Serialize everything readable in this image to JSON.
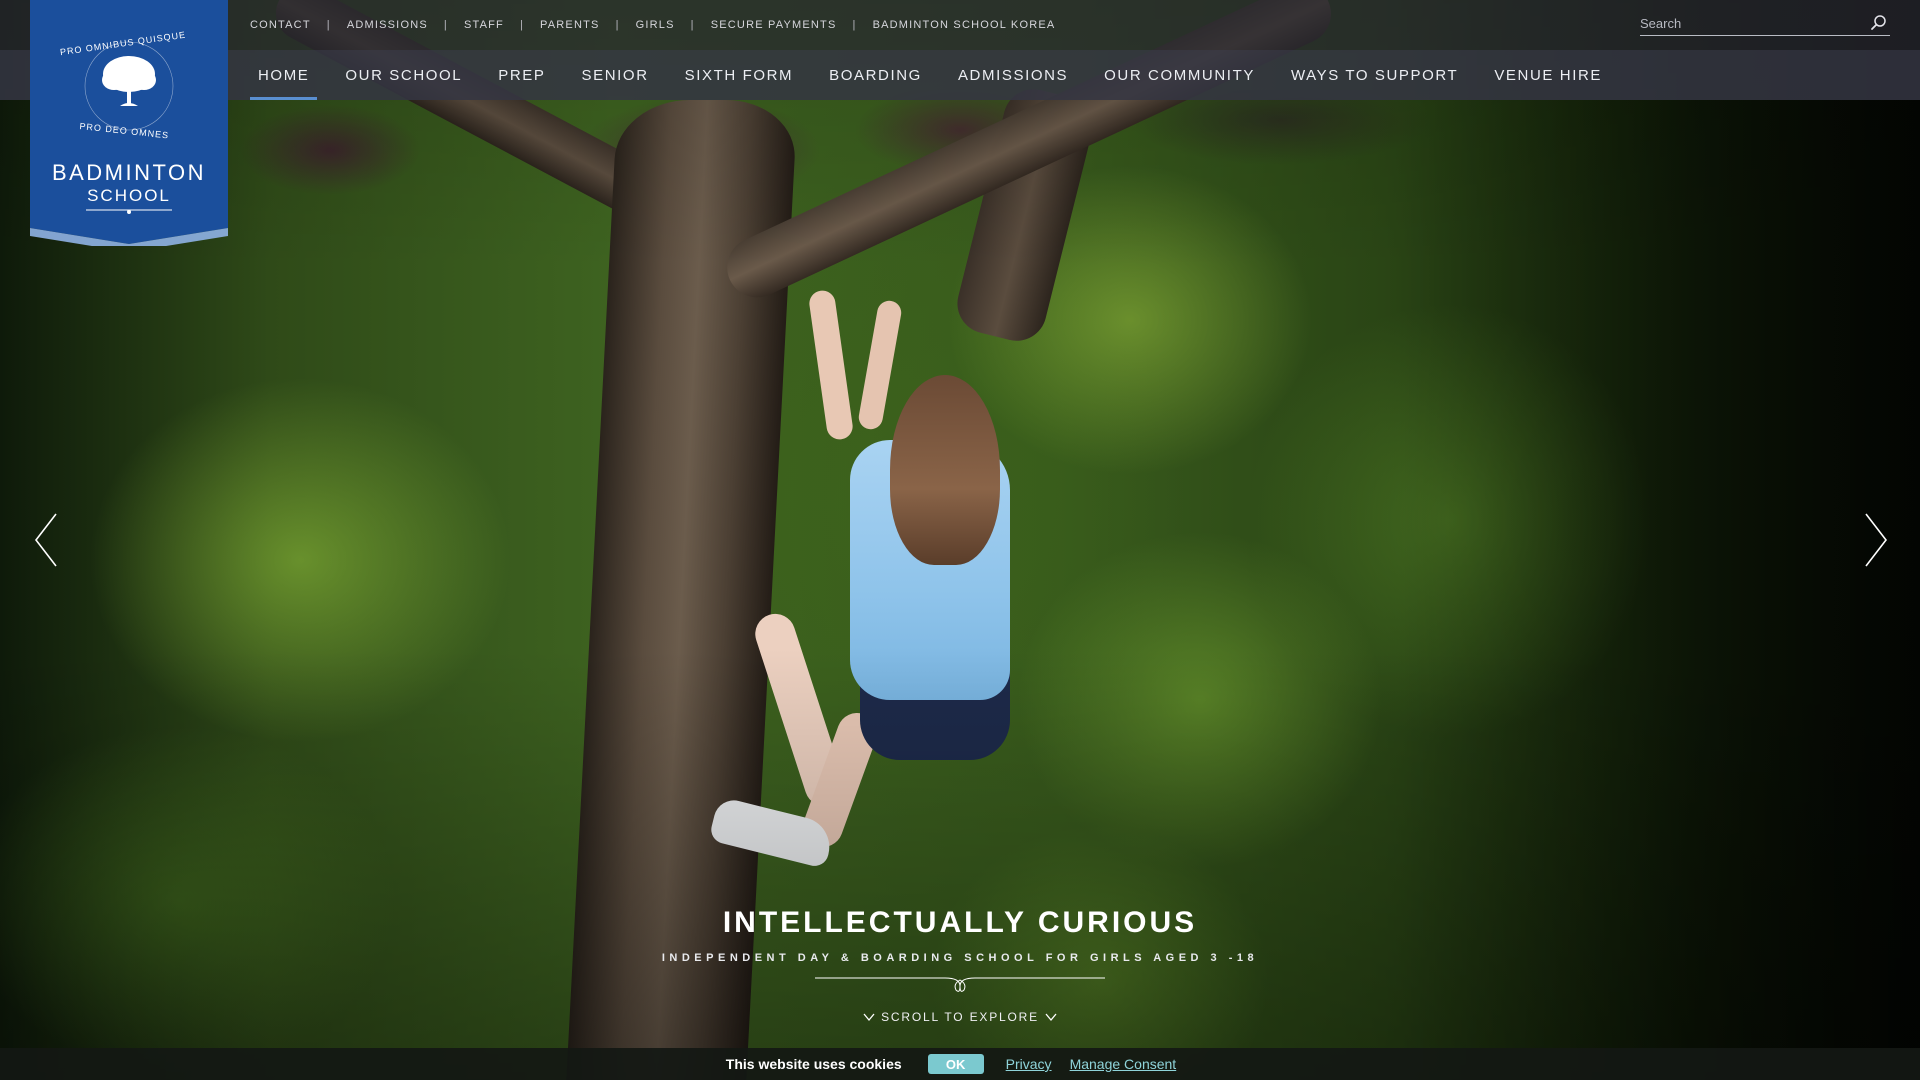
{
  "utility_nav": {
    "links": [
      "CONTACT",
      "ADMISSIONS",
      "STAFF",
      "PARENTS",
      "GIRLS",
      "SECURE PAYMENTS",
      "BADMINTON SCHOOL KOREA"
    ],
    "separator": "|"
  },
  "search": {
    "placeholder": "Search",
    "icon": "magnifier-icon"
  },
  "logo": {
    "motto": "PRO OMNIBUS QUISQUE · PRO DEO OMNES",
    "name": "BADMINTON",
    "subname": "SCHOOL",
    "background_color": "#1b4f9c"
  },
  "main_nav": {
    "items": [
      "HOME",
      "OUR SCHOOL",
      "PREP",
      "SENIOR",
      "SIXTH FORM",
      "BOARDING",
      "ADMISSIONS",
      "OUR COMMUNITY",
      "WAYS TO SUPPORT",
      "VENUE HIRE"
    ],
    "active": "HOME",
    "active_color": "#5a8fd0"
  },
  "hero": {
    "title": "INTELLECTUALLY CURIOUS",
    "subtitle": "INDEPENDENT DAY & BOARDING SCHOOL FOR GIRLS AGED 3 -18",
    "scroll_label": "SCROLL TO EXPLORE",
    "prev_icon": "chevron-left-icon",
    "next_icon": "chevron-right-icon"
  },
  "cookie_banner": {
    "text": "This website uses cookies",
    "ok_label": "OK",
    "privacy_label": "Privacy",
    "manage_label": "Manage Consent",
    "accent_color": "#7bc9cf"
  }
}
